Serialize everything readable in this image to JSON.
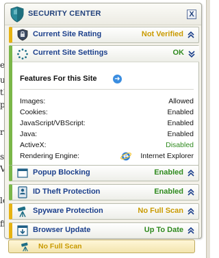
{
  "panel": {
    "title": "SECURITY CENTER",
    "close_label": "X"
  },
  "rows": {
    "rating": {
      "label": "Current Site Rating",
      "status": "Not Verified",
      "status_color": "#c99a00",
      "accent": "#e6b312"
    },
    "settings": {
      "label": "Current Site Settings",
      "status": "OK",
      "status_color": "#2f8a1e",
      "accent": "#7ab648"
    },
    "popup": {
      "label": "Popup Blocking",
      "status": "Enabled",
      "status_color": "#2f8a1e",
      "accent": "#7ab648"
    },
    "idtheft": {
      "label": "ID Theft Protection",
      "status": "Enabled",
      "status_color": "#2f8a1e",
      "accent": "#7ab648"
    },
    "spyware": {
      "label": "Spyware Protection",
      "status": "No Full Scan",
      "status_color": "#c99a00",
      "accent": "#e6b312"
    },
    "browser": {
      "label": "Browser Update",
      "status": "Up To Date",
      "status_color": "#2f8a1e",
      "accent": "#e6b312"
    }
  },
  "features": {
    "title": "Features For this Site",
    "items": [
      {
        "name": "Images:",
        "value": "Allowed",
        "value_color": "#111111"
      },
      {
        "name": "Cookies:",
        "value": "Enabled",
        "value_color": "#111111"
      },
      {
        "name": "JavaScript/VBScript:",
        "value": "Enabled",
        "value_color": "#111111"
      },
      {
        "name": "Java:",
        "value": "Enabled",
        "value_color": "#111111"
      },
      {
        "name": "ActiveX:",
        "value": "Disabled",
        "value_color": "#2f8a1e"
      },
      {
        "name": "Rendering Engine:",
        "value": "Internet Explorer",
        "value_color": "#111111"
      }
    ]
  },
  "bottom_bar": {
    "text": "No Full Scan"
  },
  "icons": {
    "title": "shield-icon",
    "rating": "shield-lock-icon",
    "settings": "gear-icon",
    "popup": "window-block-icon",
    "idtheft": "id-card-icon",
    "spyware": "telescope-icon",
    "browser": "download-icon",
    "expand": "chevron-up-icon",
    "collapse": "chevron-down-icon",
    "go": "arrow-right-icon",
    "ie": "internet-explorer-icon"
  }
}
